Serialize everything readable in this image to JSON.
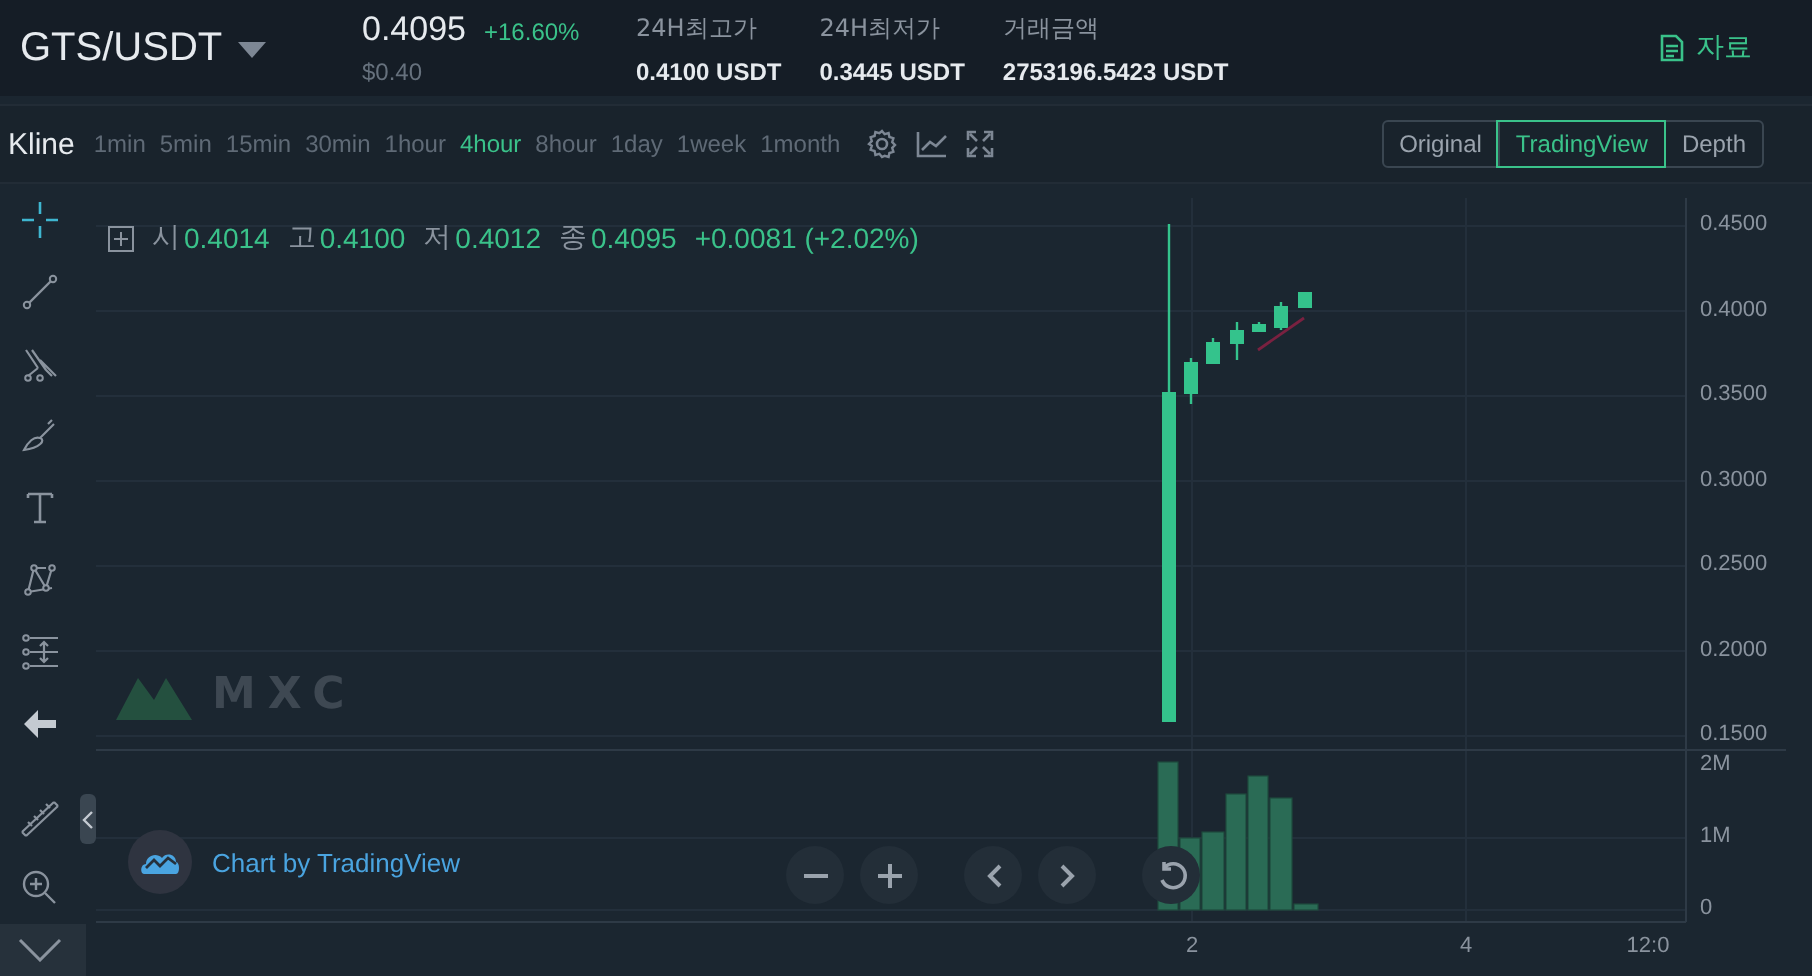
{
  "header": {
    "pair": "GTS/USDT",
    "price": "0.4095",
    "change": "+16.60%",
    "price_usd": "$0.40",
    "stats": [
      {
        "label": "24H최고가",
        "value": "0.4100 USDT"
      },
      {
        "label": "24H최저가",
        "value": "0.3445 USDT"
      },
      {
        "label": "거래금액",
        "value": "2753196.5423 USDT"
      }
    ],
    "info_button": "자료"
  },
  "toolbar": {
    "title": "Kline",
    "intervals": [
      {
        "label": "1min",
        "selected": false
      },
      {
        "label": "5min",
        "selected": false
      },
      {
        "label": "15min",
        "selected": false
      },
      {
        "label": "30min",
        "selected": false
      },
      {
        "label": "1hour",
        "selected": false
      },
      {
        "label": "4hour",
        "selected": true
      },
      {
        "label": "8hour",
        "selected": false
      },
      {
        "label": "1day",
        "selected": false
      },
      {
        "label": "1week",
        "selected": false
      },
      {
        "label": "1month",
        "selected": false
      }
    ],
    "views": [
      {
        "label": "Original",
        "selected": false
      },
      {
        "label": "TradingView",
        "selected": true
      },
      {
        "label": "Depth",
        "selected": false
      }
    ]
  },
  "legend": {
    "items": [
      {
        "label": "시",
        "value": "0.4014"
      },
      {
        "label": "고",
        "value": "0.4100"
      },
      {
        "label": "저",
        "value": "0.4012"
      },
      {
        "label": "종",
        "value": "0.4095"
      }
    ],
    "change": "+0.0081 (+2.02%)"
  },
  "watermark": "MXC",
  "attribution": "Chart by TradingView",
  "price_axis": [
    "0.4500",
    "0.4000",
    "0.3500",
    "0.3000",
    "0.2500",
    "0.2000",
    "0.1500"
  ],
  "volume_axis": [
    "2M",
    "1M",
    "0"
  ],
  "time_axis": [
    "2",
    "4",
    "12:0"
  ]
}
